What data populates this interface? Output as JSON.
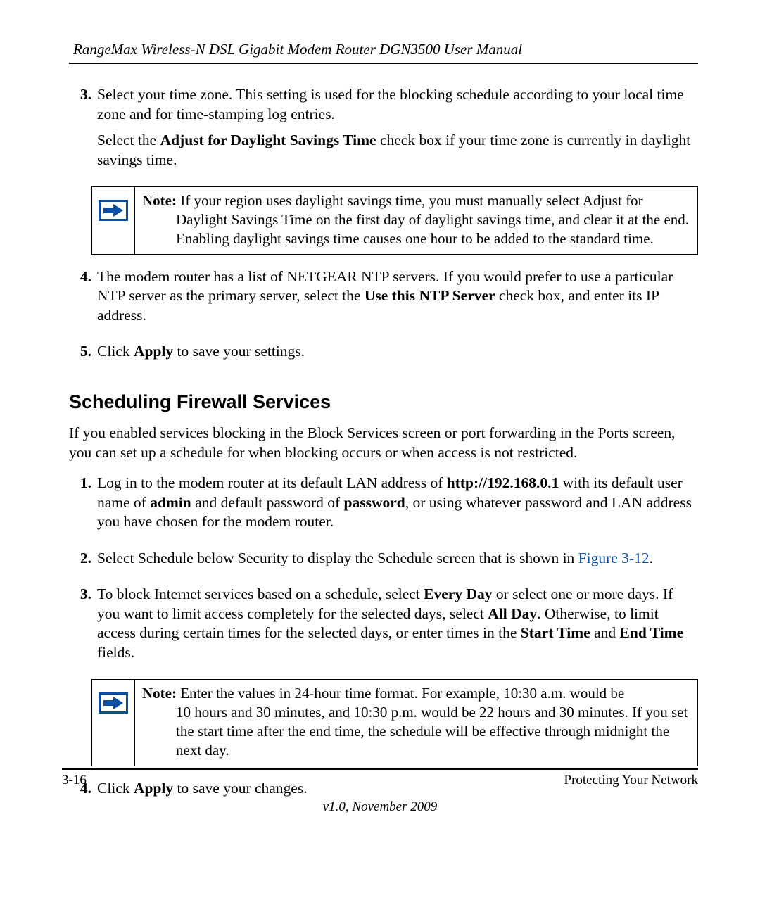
{
  "header": {
    "title": "RangeMax Wireless-N DSL Gigabit Modem Router DGN3500 User Manual"
  },
  "list1": {
    "n3": "3.",
    "p3a_a": "Select your time zone. This setting is used for the blocking schedule according to your local time zone and for time-stamping log entries.",
    "p3b_a": "Select the ",
    "p3b_b": "Adjust for Daylight Savings Time",
    "p3b_c": " check box if your time zone is currently in daylight savings time.",
    "n4": "4.",
    "p4_a": "The modem router has a list of NETGEAR NTP servers. If you would prefer to use a particular NTP server as the primary server, select the ",
    "p4_b": "Use this NTP Server",
    "p4_c": " check box, and enter its IP address.",
    "n5": "5.",
    "p5_a": "Click ",
    "p5_b": "Apply",
    "p5_c": " to save your settings."
  },
  "note1": {
    "label": "Note:",
    "first": " If your region uses daylight savings time, you must manually select Adjust for",
    "rest": "Daylight Savings Time on the first day of daylight savings time, and clear it at the end. Enabling daylight savings time causes one hour to be added to the standard time."
  },
  "heading2": "Scheduling Firewall Services",
  "intro": "If you enabled services blocking in the Block Services screen or port forwarding in the Ports screen, you can set up a schedule for when blocking occurs or when access is not restricted.",
  "list2": {
    "n1": "1.",
    "p1_a": "Log in to the modem router at its default LAN address of ",
    "p1_b": "http://192.168.0.1",
    "p1_c": " with its default user name of ",
    "p1_d": "admin",
    "p1_e": " and default password of ",
    "p1_f": "password",
    "p1_g": ", or using whatever password and LAN address you have chosen for the modem router.",
    "n2": "2.",
    "p2_a": "Select Schedule below Security to display the Schedule screen that is shown in ",
    "p2_link": "Figure 3-12",
    "p2_b": ".",
    "n3": "3.",
    "p3_a": "To block Internet services based on a schedule, select ",
    "p3_b": "Every Day",
    "p3_c": " or select one or more days. If you want to limit access completely for the selected days, select ",
    "p3_d": "All Day",
    "p3_e": ". Otherwise, to limit access during certain times for the selected days, or enter times in the ",
    "p3_f": "Start Time",
    "p3_g": " and ",
    "p3_h": "End Time",
    "p3_i": " fields.",
    "n4": "4.",
    "p4_a": "Click ",
    "p4_b": "Apply",
    "p4_c": " to save your changes."
  },
  "note2": {
    "label": "Note:",
    "first": " Enter the values in 24-hour time format. For example, 10:30 a.m. would be",
    "rest": "10 hours and 30 minutes, and 10:30 p.m. would be 22 hours and 30 minutes. If you set the start time after the end time, the schedule will be effective through midnight the next day."
  },
  "footer": {
    "page": "3-16",
    "section": "Protecting Your Network",
    "version": "v1.0, November 2009"
  }
}
